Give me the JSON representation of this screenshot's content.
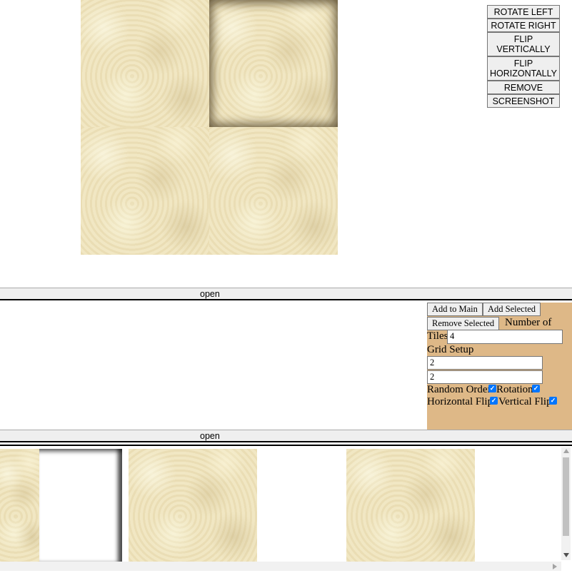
{
  "toolbar": {
    "rotate_left": "ROTATE LEFT",
    "rotate_right": "ROTATE RIGHT",
    "flip_vertically": "FLIP VERTICALLY",
    "flip_horizontally": "FLIP HORIZONTALLY",
    "remove": "REMOVE",
    "screenshot": "SCREENSHOT"
  },
  "dividers": {
    "first_label": "open",
    "second_label": "open"
  },
  "controls": {
    "add_to_main": "Add to Main",
    "add_selected": "Add Selected",
    "remove_selected": "Remove Selected",
    "number_of_tiles_label_a": "Number of",
    "number_of_tiles_label_b": "Tiles",
    "number_of_tiles_value": "4",
    "grid_setup_label": "Grid Setup",
    "grid_rows_value": "2",
    "grid_cols_value": "2",
    "random_order_label": "Random Order",
    "random_order_checked": true,
    "rotation_label": "Rotation",
    "rotation_checked": true,
    "horizontal_flip_label": "Horizontal Flip",
    "horizontal_flip_checked": true,
    "vertical_flip_label": "Vertical Flip",
    "vertical_flip_checked": true,
    "panel_color": "#deb887",
    "checkbox_color": "#0075ff"
  }
}
